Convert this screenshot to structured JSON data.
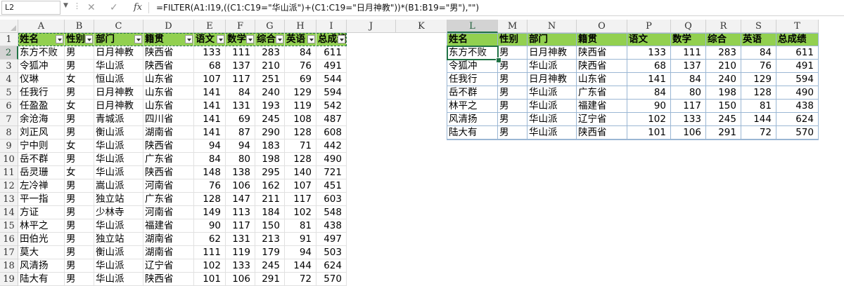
{
  "formula_bar": {
    "name_box": "L2",
    "fx": "fx",
    "cancel": "✕",
    "enter": "✓",
    "formula": "=FILTER(A1:I19,((C1:C19=\"华山派\")+(C1:C19=\"日月神教\"))*(B1:B19=\"男\"),\"\")"
  },
  "columns": [
    "A",
    "B",
    "C",
    "D",
    "E",
    "F",
    "G",
    "H",
    "I",
    "J",
    "K",
    "L",
    "M",
    "N",
    "O",
    "P",
    "Q",
    "R",
    "S",
    "T"
  ],
  "rows": [
    "1",
    "2",
    "3",
    "4",
    "5",
    "6",
    "7",
    "8",
    "9",
    "10",
    "11",
    "12",
    "13",
    "14",
    "15",
    "16",
    "17",
    "18",
    "19"
  ],
  "selected_column": "L",
  "selected_row": "2",
  "source_table": {
    "headers": [
      "姓名",
      "性别",
      "部门",
      "籍贯",
      "语文",
      "数学",
      "综合",
      "英语",
      "总成绩"
    ],
    "rows": [
      [
        "东方不败",
        "男",
        "日月神教",
        "陕西省",
        "133",
        "111",
        "283",
        "84",
        "611"
      ],
      [
        "令狐冲",
        "男",
        "华山派",
        "陕西省",
        "68",
        "137",
        "210",
        "76",
        "491"
      ],
      [
        "仪琳",
        "女",
        "恒山派",
        "山东省",
        "107",
        "117",
        "251",
        "69",
        "544"
      ],
      [
        "任我行",
        "男",
        "日月神教",
        "山东省",
        "141",
        "84",
        "240",
        "129",
        "594"
      ],
      [
        "任盈盈",
        "女",
        "日月神教",
        "山东省",
        "141",
        "131",
        "193",
        "119",
        "542"
      ],
      [
        "余沧海",
        "男",
        "青城派",
        "四川省",
        "141",
        "69",
        "245",
        "108",
        "487"
      ],
      [
        "刘正风",
        "男",
        "衡山派",
        "湖南省",
        "141",
        "87",
        "290",
        "128",
        "608"
      ],
      [
        "宁中则",
        "女",
        "华山派",
        "陕西省",
        "94",
        "94",
        "183",
        "71",
        "442"
      ],
      [
        "岳不群",
        "男",
        "华山派",
        "广东省",
        "84",
        "80",
        "198",
        "128",
        "490"
      ],
      [
        "岳灵珊",
        "女",
        "华山派",
        "陕西省",
        "148",
        "138",
        "295",
        "140",
        "721"
      ],
      [
        "左冷禅",
        "男",
        "嵩山派",
        "河南省",
        "76",
        "106",
        "162",
        "107",
        "451"
      ],
      [
        "平一指",
        "男",
        "独立站",
        "广东省",
        "128",
        "147",
        "211",
        "117",
        "603"
      ],
      [
        "方证",
        "男",
        "少林寺",
        "河南省",
        "149",
        "113",
        "184",
        "102",
        "548"
      ],
      [
        "林平之",
        "男",
        "华山派",
        "福建省",
        "90",
        "117",
        "150",
        "81",
        "438"
      ],
      [
        "田伯光",
        "男",
        "独立站",
        "湖南省",
        "62",
        "131",
        "213",
        "91",
        "497"
      ],
      [
        "莫大",
        "男",
        "衡山派",
        "湖南省",
        "111",
        "119",
        "179",
        "94",
        "503"
      ],
      [
        "风清扬",
        "男",
        "华山派",
        "辽宁省",
        "102",
        "133",
        "245",
        "144",
        "624"
      ],
      [
        "陆大有",
        "男",
        "华山派",
        "陕西省",
        "101",
        "106",
        "291",
        "72",
        "570"
      ]
    ]
  },
  "result_table": {
    "headers": [
      "姓名",
      "性别",
      "部门",
      "籍贯",
      "语文",
      "数学",
      "综合",
      "英语",
      "总成绩"
    ],
    "rows": [
      [
        "东方不败",
        "男",
        "日月神教",
        "陕西省",
        "133",
        "111",
        "283",
        "84",
        "611"
      ],
      [
        "令狐冲",
        "男",
        "华山派",
        "陕西省",
        "68",
        "137",
        "210",
        "76",
        "491"
      ],
      [
        "任我行",
        "男",
        "日月神教",
        "山东省",
        "141",
        "84",
        "240",
        "129",
        "594"
      ],
      [
        "岳不群",
        "男",
        "华山派",
        "广东省",
        "84",
        "80",
        "198",
        "128",
        "490"
      ],
      [
        "林平之",
        "男",
        "华山派",
        "福建省",
        "90",
        "117",
        "150",
        "81",
        "438"
      ],
      [
        "风清扬",
        "男",
        "华山派",
        "辽宁省",
        "102",
        "133",
        "245",
        "144",
        "624"
      ],
      [
        "陆大有",
        "男",
        "华山派",
        "陕西省",
        "101",
        "106",
        "291",
        "72",
        "570"
      ]
    ]
  },
  "colors": {
    "header_fill": "#92d050",
    "selection": "#217346"
  }
}
